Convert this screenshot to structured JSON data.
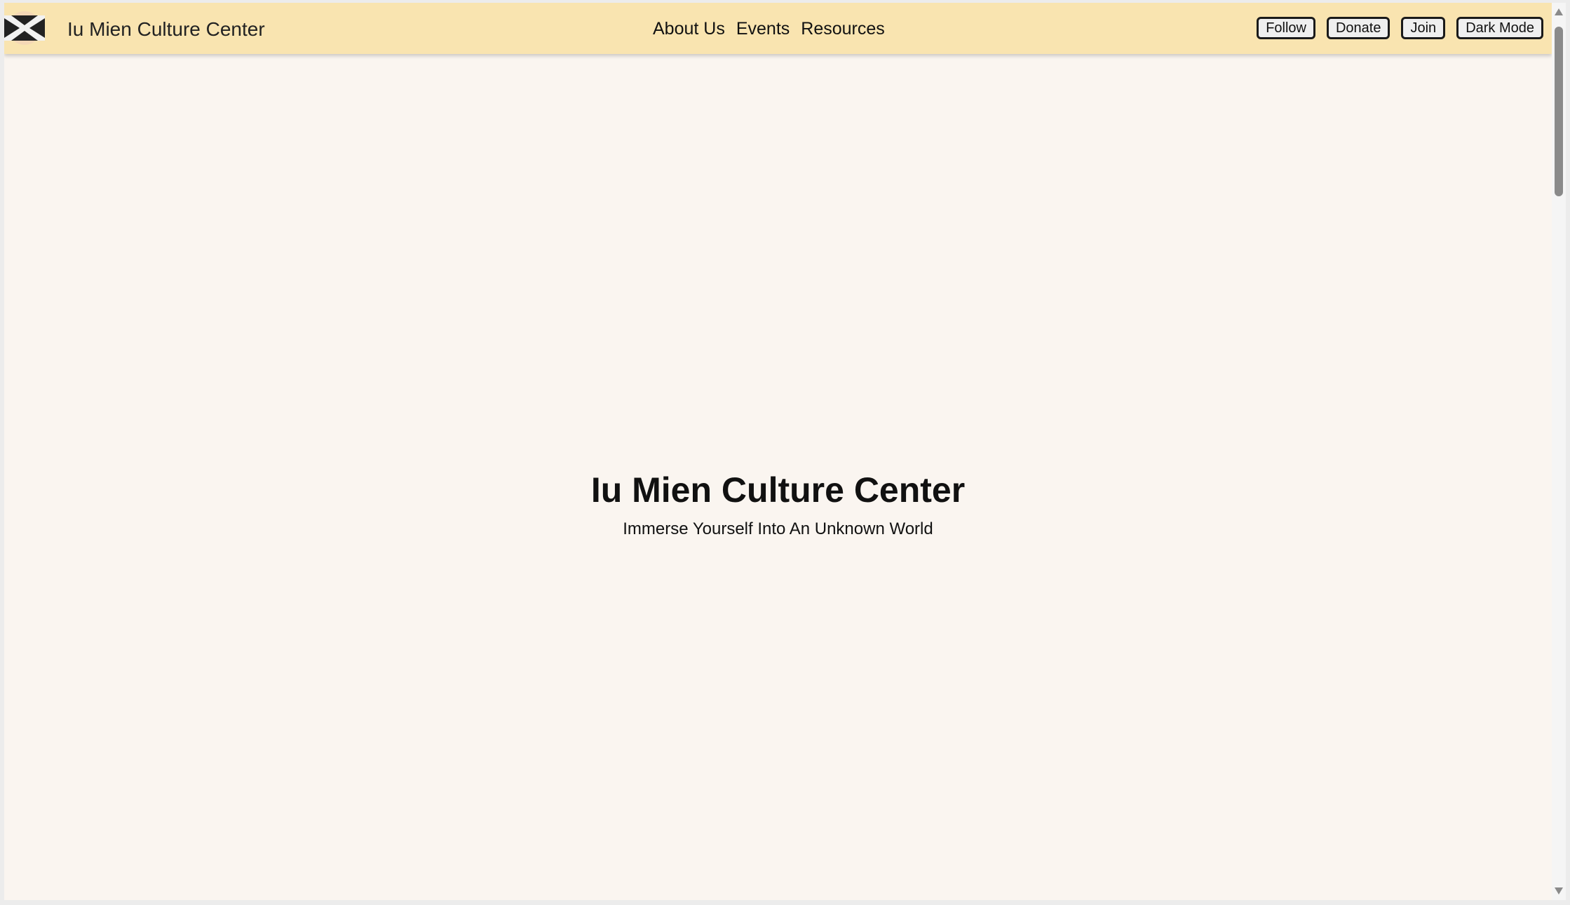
{
  "header": {
    "brand": "Iu Mien Culture Center",
    "logo_icon": "crossed-flag-icon",
    "nav_links": [
      "About Us",
      "Events",
      "Resources"
    ],
    "buttons": [
      "Follow",
      "Donate",
      "Join",
      "Dark Mode"
    ]
  },
  "hero": {
    "title": "Iu Mien Culture Center",
    "subtitle": "Immerse Yourself Into An Unknown World"
  },
  "colors": {
    "navbar_bg": "#f9e4b0",
    "page_bg": "#faf5f0",
    "text": "#111111"
  }
}
